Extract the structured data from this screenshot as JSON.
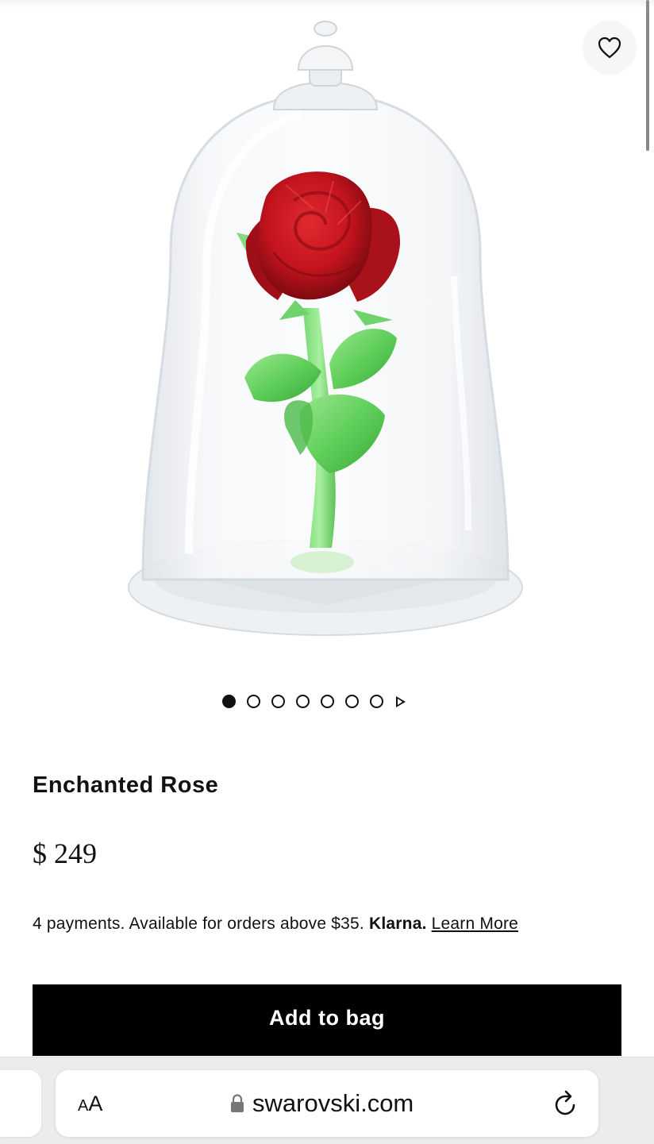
{
  "wishlist": {
    "icon": "heart-outline-icon"
  },
  "hero": {
    "image": "enchanted-rose-in-glass-dome",
    "colors": {
      "petal": "#c4141e",
      "leaf": "#5fcf5a",
      "glass": "#e9edf1"
    }
  },
  "gallery": {
    "total": 7,
    "active_index": 1,
    "next_icon": "play-icon"
  },
  "product": {
    "name": "Enchanted Rose",
    "price": "$ 249",
    "payments_text": "4 payments. Available for orders above $35.",
    "klarna_label": "Klarna.",
    "learn_more_label": "Learn More"
  },
  "actions": {
    "add_to_bag_label": "Add to bag"
  },
  "browser": {
    "text_size_small": "A",
    "text_size_large": "A",
    "url": "swarovski.com",
    "lock_icon": "lock-icon",
    "reload_icon": "reload-icon"
  }
}
